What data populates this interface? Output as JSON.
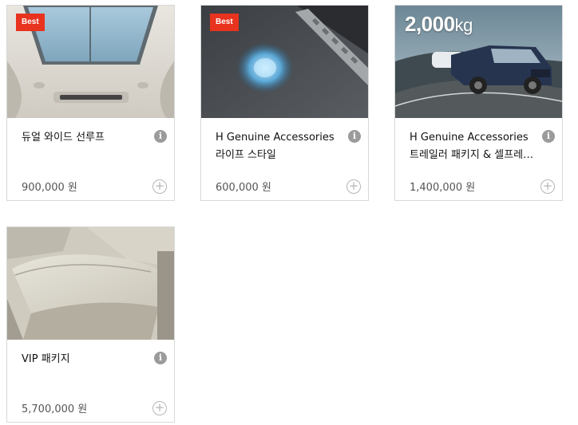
{
  "products": [
    {
      "name": "듀얼 와이드 선루프",
      "price": "900,000 원",
      "badge": "Best",
      "info_icon": "i",
      "add_icon": "+"
    },
    {
      "name": "H Genuine Accessories 라이프 스타일",
      "price": "600,000 원",
      "badge": "Best",
      "info_icon": "i",
      "add_icon": "+"
    },
    {
      "name": "H Genuine Accessories 트레일러 패키지 & 셀프레벨라…",
      "price": "1,400,000 원",
      "overlay_value": "2,000",
      "overlay_unit": "kg",
      "info_icon": "i",
      "add_icon": "+"
    },
    {
      "name": "VIP 패키지",
      "price": "5,700,000 원",
      "info_icon": "i",
      "add_icon": "+"
    }
  ],
  "colors": {
    "badge": "#e8331e",
    "border": "#d8d8d8",
    "icon_gray": "#9b9b9b"
  }
}
